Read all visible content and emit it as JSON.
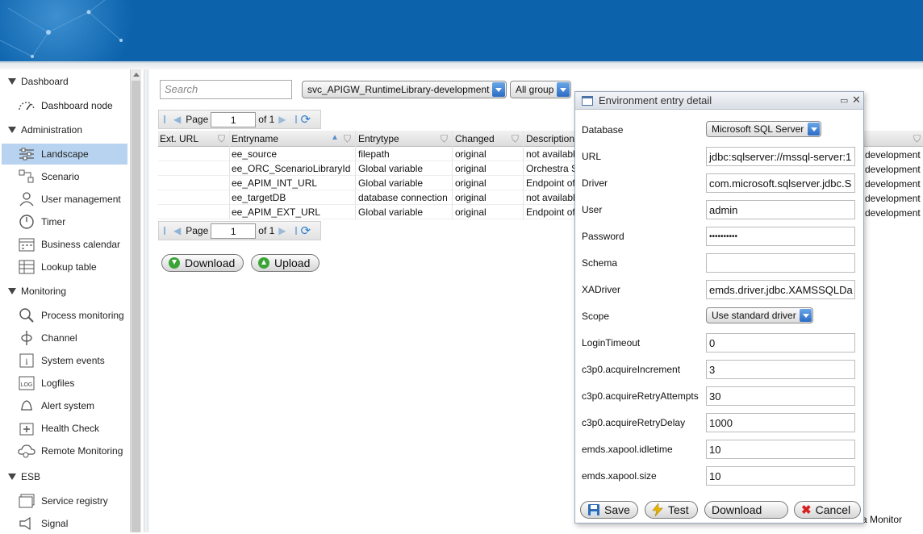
{
  "sidebar": {
    "sections": [
      "Dashboard",
      "Administration",
      "Monitoring",
      "ESB"
    ],
    "items": [
      {
        "label": "Dashboard node",
        "icon": "gauge-icon"
      },
      {
        "label": "Landscape",
        "icon": "sliders-icon"
      },
      {
        "label": "Scenario",
        "icon": "scenario-icon"
      },
      {
        "label": "User management",
        "icon": "user-icon"
      },
      {
        "label": "Timer",
        "icon": "clock-icon"
      },
      {
        "label": "Business calendar",
        "icon": "calendar-icon"
      },
      {
        "label": "Lookup table",
        "icon": "table-icon"
      },
      {
        "label": "Process monitoring",
        "icon": "magnifier-icon"
      },
      {
        "label": "Channel",
        "icon": "channel-icon"
      },
      {
        "label": "System events",
        "icon": "info-icon"
      },
      {
        "label": "Logfiles",
        "icon": "log-icon"
      },
      {
        "label": "Alert system",
        "icon": "bell-icon"
      },
      {
        "label": "Health Check",
        "icon": "health-icon"
      },
      {
        "label": "Remote Monitoring",
        "icon": "cloud-gear-icon"
      },
      {
        "label": "Service registry",
        "icon": "registry-icon"
      },
      {
        "label": "Signal",
        "icon": "signal-icon"
      }
    ]
  },
  "toolbar": {
    "search_placeholder": "Search",
    "environment": "svc_APIGW_RuntimeLibrary-development",
    "group": "All group"
  },
  "pager": {
    "label": "Page",
    "page": "1",
    "of": "of 1"
  },
  "grid": {
    "columns": [
      "Ext. URL",
      "Entryname",
      "Entrytype",
      "Changed",
      "Description"
    ],
    "rows": [
      {
        "name": "ee_source",
        "type": "filepath",
        "changed": "original",
        "desc": "not availabl"
      },
      {
        "name": "ee_ORC_ScenarioLibraryId",
        "type": "Global variable",
        "changed": "original",
        "desc": "Orchestra S"
      },
      {
        "name": "ee_APIM_INT_URL",
        "type": "Global variable",
        "changed": "original",
        "desc": "Endpoint of"
      },
      {
        "name": "ee_targetDB",
        "type": "database connection",
        "changed": "original",
        "desc": "not availabl"
      },
      {
        "name": "ee_APIM_EXT_URL",
        "type": "Global variable",
        "changed": "original",
        "desc": "Endpoint of"
      }
    ],
    "right_col_text": "development"
  },
  "buttons": {
    "download": "Download",
    "upload": "Upload"
  },
  "footer_text": "a Monitor",
  "dialog": {
    "title": "Environment entry detail",
    "fields": [
      {
        "label": "Database",
        "value": "Microsoft SQL Server",
        "kind": "select"
      },
      {
        "label": "URL",
        "value": "jdbc:sqlserver://mssql-server:1",
        "kind": "input"
      },
      {
        "label": "Driver",
        "value": "com.microsoft.sqlserver.jdbc.S",
        "kind": "input"
      },
      {
        "label": "User",
        "value": "admin",
        "kind": "input"
      },
      {
        "label": "Password",
        "value": "••••••••••",
        "kind": "input"
      },
      {
        "label": "Schema",
        "value": "",
        "kind": "input"
      },
      {
        "label": "XADriver",
        "value": "emds.driver.jdbc.XAMSSQLDa",
        "kind": "input"
      },
      {
        "label": "Scope",
        "value": "Use standard driver",
        "kind": "select"
      },
      {
        "label": "LoginTimeout",
        "value": "0",
        "kind": "input"
      },
      {
        "label": "c3p0.acquireIncrement",
        "value": "3",
        "kind": "input"
      },
      {
        "label": "c3p0.acquireRetryAttempts",
        "value": "30",
        "kind": "input"
      },
      {
        "label": "c3p0.acquireRetryDelay",
        "value": "1000",
        "kind": "input"
      },
      {
        "label": "emds.xapool.idletime",
        "value": "10",
        "kind": "input"
      },
      {
        "label": "emds.xapool.size",
        "value": "10",
        "kind": "input"
      }
    ],
    "buttons": {
      "save": "Save",
      "test": "Test",
      "download": "Download",
      "cancel": "Cancel"
    },
    "colors": {
      "save": "#2e6db5",
      "test": "#e8b400",
      "download": "#3aa536",
      "cancel": "#d62020"
    }
  }
}
